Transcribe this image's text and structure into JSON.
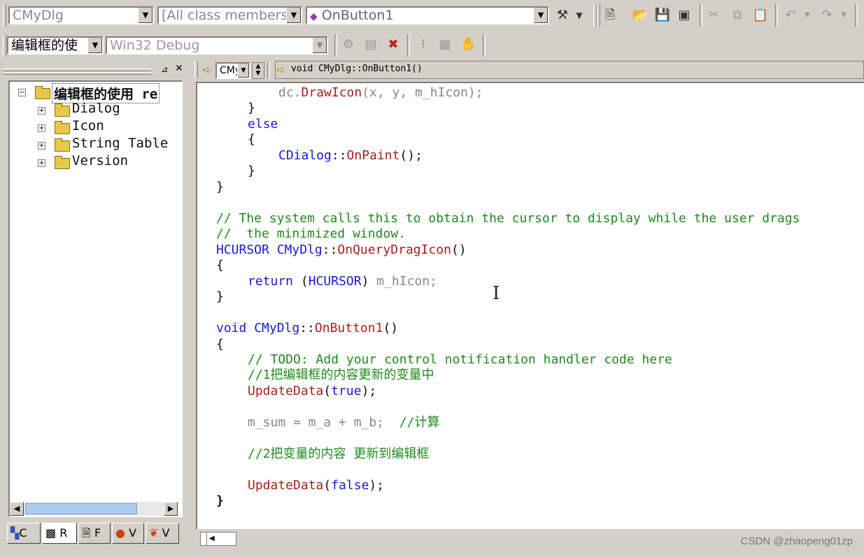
{
  "toolbar1": {
    "class_combo": "CMyDlg",
    "filter_combo": "[All class members]",
    "member_combo": "OnButton1"
  },
  "toolbar2": {
    "project_combo": "编辑框的使",
    "config_combo": "Win32 Debug"
  },
  "workspace": {
    "tree_root": "编辑框的使用 re",
    "tree_items": [
      "Dialog",
      "Icon",
      "String Table",
      "Version"
    ],
    "tabs": [
      "C",
      "R",
      "F",
      "V",
      "V"
    ]
  },
  "wizardbar": {
    "class_combo": "CMy",
    "function_label": "void CMyDlg::OnButton1()"
  },
  "code": {
    "l1_a": "dc.",
    "l1_b": "DrawIcon",
    "l1_c": "(x, y, m_hIcon);",
    "l2": "}",
    "l3": "else",
    "l4": "{",
    "l5_a": "CDialog",
    "l5_b": "::",
    "l5_c": "OnPaint",
    "l5_d": "();",
    "l6": "}",
    "l7": "}",
    "l8": "// The system calls this to obtain the cursor to display while the user drags",
    "l9": "//  the minimized window.",
    "l10_a": "HCURSOR",
    "l10_b": "CMyDlg",
    "l10_c": "::",
    "l10_d": "OnQueryDragIcon",
    "l10_e": "()",
    "l11": "{",
    "l12_a": "return",
    "l12_b": "(",
    "l12_c": "HCURSOR",
    "l12_d": ")",
    "l12_e": "m_hIcon;",
    "l13": "}",
    "l14_a": "void",
    "l14_b": "CMyDlg",
    "l14_c": "::",
    "l14_d": "OnButton1",
    "l14_e": "()",
    "l15": "{",
    "l16": "// TODO: Add your control notification handler code here",
    "l17": "//1把编辑框的内容更新的变量中",
    "l18_a": "UpdateData",
    "l18_b": "(",
    "l18_c": "true",
    "l18_d": ");",
    "l19_a": "m_sum = m_a + m_b;",
    "l19_b": "//计算",
    "l20": "//2把变量的内容 更新到编辑框",
    "l21_a": "UpdateData",
    "l21_b": "(",
    "l21_c": "false",
    "l21_d": ");",
    "l22": "}"
  },
  "watermark": "CSDN @zhaopeng01zp"
}
